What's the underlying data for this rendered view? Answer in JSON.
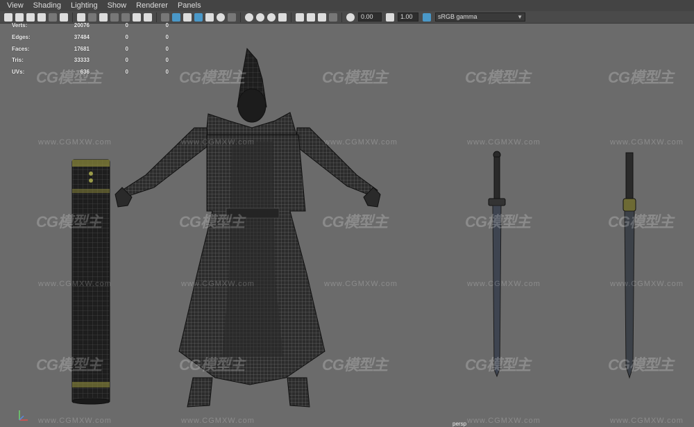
{
  "menu": [
    "View",
    "Shading",
    "Lighting",
    "Show",
    "Renderer",
    "Panels"
  ],
  "toolbar": {
    "exposure": "0.00",
    "gamma": "1.00",
    "color_space": "sRGB gamma"
  },
  "hud": [
    {
      "label": "Verts:",
      "v1": "20076",
      "v2": "0",
      "v3": "0"
    },
    {
      "label": "Edges:",
      "v1": "37484",
      "v2": "0",
      "v3": "0"
    },
    {
      "label": "Faces:",
      "v1": "17681",
      "v2": "0",
      "v3": "0"
    },
    {
      "label": "Tris:",
      "v1": "33333",
      "v2": "0",
      "v3": "0"
    },
    {
      "label": "UVs:",
      "v1": "636",
      "v2": "0",
      "v3": "0"
    }
  ],
  "watermark": {
    "logo": "CG模型主",
    "url": "www.CGMXW.com"
  },
  "camera_label": "persp"
}
